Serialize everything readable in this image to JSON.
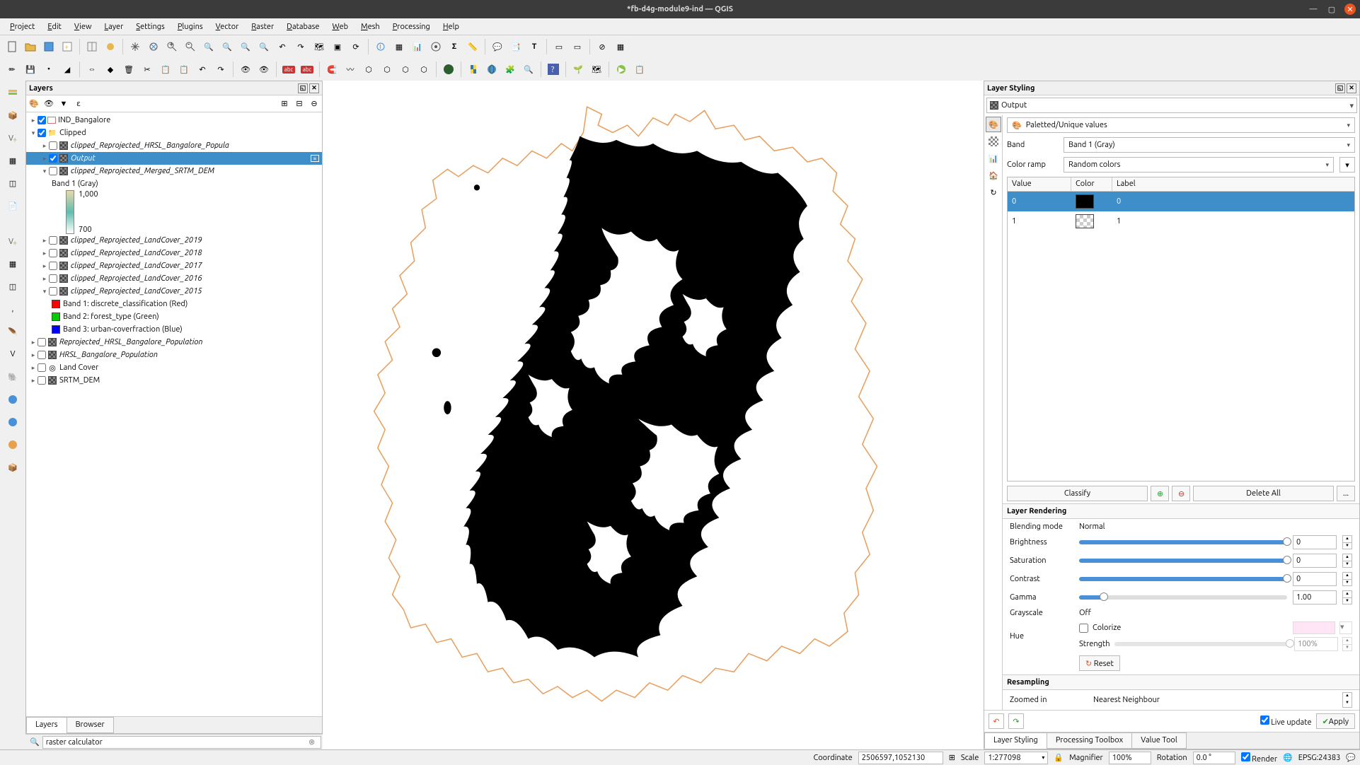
{
  "window": {
    "title": "*fb-d4g-module9-ind — QGIS"
  },
  "menubar": [
    "Project",
    "Edit",
    "View",
    "Layer",
    "Settings",
    "Plugins",
    "Vector",
    "Raster",
    "Database",
    "Web",
    "Mesh",
    "Processing",
    "Help"
  ],
  "layers_panel": {
    "title": "Layers",
    "tabs": [
      "Layers",
      "Browser"
    ],
    "active_tab": "Layers",
    "tree": [
      {
        "type": "layer",
        "checked": true,
        "name": "IND_Bangalore",
        "icon": "polygon",
        "indent": 0,
        "selected": false,
        "plain": true
      },
      {
        "type": "group",
        "checked": true,
        "name": "Clipped",
        "indent": 0,
        "expanded": true,
        "plain": true
      },
      {
        "type": "layer",
        "checked": false,
        "name": "clipped_Reprojected_HRSL_Bangalore_Popula",
        "icon": "raster",
        "indent": 1
      },
      {
        "type": "layer",
        "checked": true,
        "name": "Output",
        "icon": "raster",
        "indent": 1,
        "selected": true
      },
      {
        "type": "layer",
        "checked": false,
        "name": "clipped_Reprojected_Merged_SRTM_DEM",
        "icon": "raster",
        "indent": 1,
        "expanded": true
      },
      {
        "type": "band-label",
        "text": "Band 1 (Gray)",
        "indent": 2
      },
      {
        "type": "gradient",
        "top": "1,000",
        "bottom": "700"
      },
      {
        "type": "layer",
        "checked": false,
        "name": "clipped_Reprojected_LandCover_2019",
        "icon": "raster",
        "indent": 1
      },
      {
        "type": "layer",
        "checked": false,
        "name": "clipped_Reprojected_LandCover_2018",
        "icon": "raster",
        "indent": 1
      },
      {
        "type": "layer",
        "checked": false,
        "name": "clipped_Reprojected_LandCover_2017",
        "icon": "raster",
        "indent": 1
      },
      {
        "type": "layer",
        "checked": false,
        "name": "clipped_Reprojected_LandCover_2016",
        "icon": "raster",
        "indent": 1
      },
      {
        "type": "layer",
        "checked": false,
        "name": "clipped_Reprojected_LandCover_2015",
        "icon": "raster",
        "indent": 1,
        "expanded": true
      },
      {
        "type": "color-band",
        "color": "#ff0000",
        "text": "Band 1: discrete_classification (Red)",
        "indent": 2
      },
      {
        "type": "color-band",
        "color": "#00cc00",
        "text": "Band 2: forest_type (Green)",
        "indent": 2
      },
      {
        "type": "color-band",
        "color": "#0000ff",
        "text": "Band 3: urban-coverfraction (Blue)",
        "indent": 2
      },
      {
        "type": "layer",
        "checked": false,
        "name": "Reprojected_HRSL_Bangalore_Population",
        "icon": "raster",
        "indent": 0
      },
      {
        "type": "layer",
        "checked": false,
        "name": "HRSL_Bangalore_Population",
        "icon": "raster",
        "indent": 0
      },
      {
        "type": "layer",
        "checked": false,
        "name": "Land Cover",
        "icon": "other",
        "indent": 0,
        "plain": true
      },
      {
        "type": "layer",
        "checked": false,
        "name": "SRTM_DEM",
        "icon": "raster",
        "indent": 0,
        "plain": true
      }
    ]
  },
  "search": {
    "placeholder": "",
    "value": "raster calculator",
    "icon": "Q"
  },
  "styling_panel": {
    "title": "Layer Styling",
    "layer": "Output",
    "renderer": "Paletted/Unique values",
    "band_label": "Band",
    "band_value": "Band 1 (Gray)",
    "ramp_label": "Color ramp",
    "ramp_value": "Random colors",
    "table_headers": [
      "Value",
      "Color",
      "Label"
    ],
    "table_rows": [
      {
        "value": "0",
        "color": "black",
        "label": "0",
        "selected": true
      },
      {
        "value": "1",
        "color": "trans",
        "label": "1",
        "selected": false
      }
    ],
    "classify": "Classify",
    "delete_all": "Delete All",
    "more": "...",
    "rendering_header": "Layer Rendering",
    "blending_label": "Blending mode",
    "blending_value": "Normal",
    "brightness_label": "Brightness",
    "brightness_value": "0",
    "saturation_label": "Saturation",
    "saturation_value": "0",
    "contrast_label": "Contrast",
    "contrast_value": "0",
    "gamma_label": "Gamma",
    "gamma_value": "1.00",
    "grayscale_label": "Grayscale",
    "grayscale_value": "Off",
    "hue_label": "Hue",
    "colorize_label": "Colorize",
    "strength_label": "Strength",
    "strength_value": "100%",
    "reset_label": "Reset",
    "resampling_header": "Resampling",
    "zoomed_in_label": "Zoomed in",
    "zoomed_in_value": "Nearest Neighbour",
    "live_update_label": "Live update",
    "apply_label": "Apply",
    "tabs": [
      "Layer Styling",
      "Processing Toolbox",
      "Value Tool"
    ],
    "active_tab": "Layer Styling"
  },
  "statusbar": {
    "coordinate_label": "Coordinate",
    "coordinate": "2506597,1052130",
    "scale_label": "Scale",
    "scale": "1:277098",
    "magnifier_label": "Magnifier",
    "magnifier": "100%",
    "rotation_label": "Rotation",
    "rotation": "0.0 °",
    "render_label": "Render",
    "crs": "EPSG:24383"
  }
}
